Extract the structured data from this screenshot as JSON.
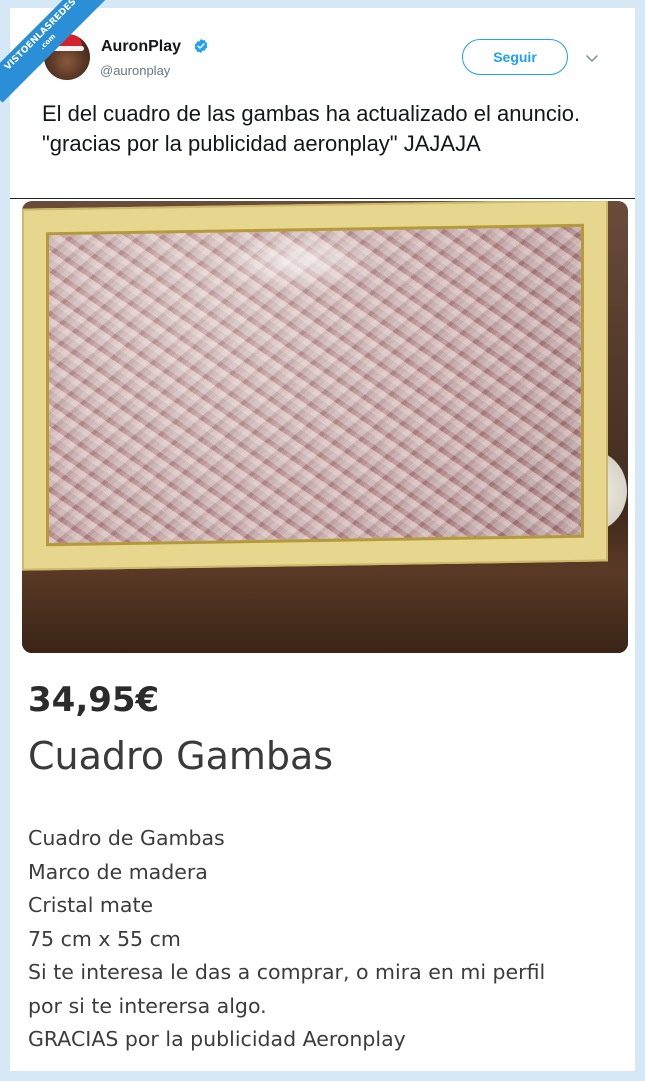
{
  "watermark": {
    "line1": "VISTOENLASREDES",
    "line2": ".com"
  },
  "author": {
    "name": "AuronPlay",
    "handle": "@auronplay",
    "verified": true
  },
  "follow_button": {
    "label": "Seguir"
  },
  "tweet": {
    "text": "El del cuadro de las gambas ha actualizado el anuncio. \"gracias por la publicidad aeronplay\" JAJAJA"
  },
  "listing": {
    "price": "34,95€",
    "title": "Cuadro Gambas",
    "description": [
      "Cuadro de Gambas",
      "Marco de madera",
      "Cristal mate",
      "75 cm x 55 cm",
      "Si te interesa le das a comprar, o mira en mi perfil",
      "por si te interersa algo.",
      "GRACIAS por la publicidad Aeronplay"
    ]
  },
  "colors": {
    "accent": "#1da1f2",
    "verified_badge": "#1da1f2",
    "page_bg": "#d6e8f5",
    "banner": "#2a8fd6"
  }
}
